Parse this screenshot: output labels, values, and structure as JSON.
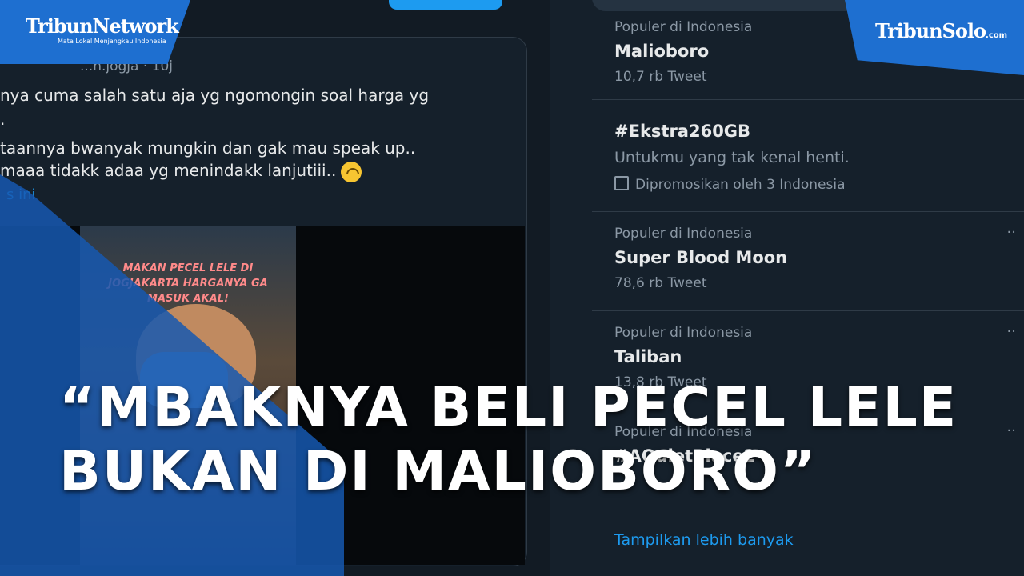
{
  "tweet": {
    "handle": "...n.jogja · 10j",
    "lines": [
      "nya cuma salah satu aja yg ngomongin soal harga yg",
      ".",
      "taannya bwanyak mungkin dan gak mau speak up..",
      "maaa tidakk adaa yg menindakk lanjutiii.."
    ],
    "more": "s ini",
    "video_caption": "MAKAN PECEL LELE DI JOGJAKARTA HARGANYA GA MASUK AKAL!"
  },
  "trends": [
    {
      "meta": "Populer di Indonesia",
      "name": "Malioboro",
      "count": "10,7 rb Tweet"
    },
    {
      "meta": "",
      "name": "#Ekstra260GB",
      "count": "Untukmu yang tak kenal henti.",
      "promo": "Dipromosikan oleh 3 Indonesia"
    },
    {
      "meta": "Populer di Indonesia",
      "name": "Super Blood Moon",
      "count": "78,6 rb Tweet"
    },
    {
      "meta": "Populer di Indonesia",
      "name": "Taliban",
      "count": "13,8 rb Tweet"
    },
    {
      "meta": "Populer di Indonesia",
      "name": "#AQuietPlace2",
      "count": ""
    }
  ],
  "show_more": "Tampilkan lebih banyak",
  "logos": {
    "left_brand": "TribunNetwork",
    "left_tagline": "Mata Lokal Menjangkau Indonesia",
    "right_brand": "TribunSolo",
    "right_suffix": ".com"
  },
  "headline": {
    "line1": "“MBAKNYA BELI PECEL LELE",
    "line2": "BUKAN DI MALIOBORO”"
  },
  "colors": {
    "accent": "#1d9bf0",
    "brand_blue": "#1e6fd0"
  }
}
